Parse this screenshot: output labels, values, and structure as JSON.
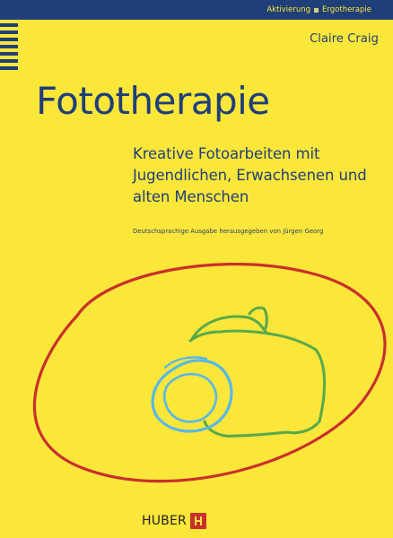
{
  "series": {
    "left": "Aktivierung",
    "right": "Ergotherapie"
  },
  "author": "Claire Craig",
  "title": "Fototherapie",
  "subtitle_lines": [
    "Kreative Fotoarbeiten mit",
    "Jugendlichen, Erwachsenen und",
    "alten Menschen"
  ],
  "editor_note": "Deutschsprachige Ausgabe herausgegeben von Jürgen Georg",
  "publisher": {
    "name": "HUBER"
  },
  "illustration": {
    "name": "camera-illustration"
  },
  "colors": {
    "background": "#fbe63a",
    "navy": "#1f3f78",
    "red": "#c9302c",
    "green": "#58a94a",
    "light_blue": "#58b8e6"
  }
}
